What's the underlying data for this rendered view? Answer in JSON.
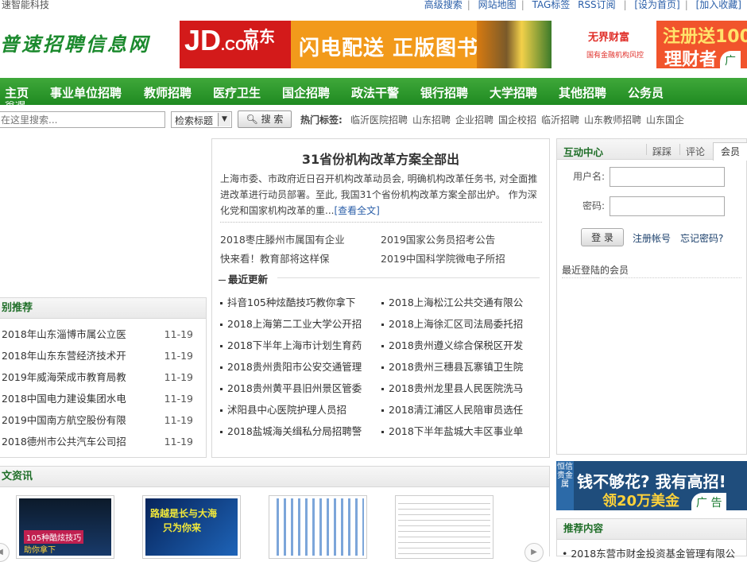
{
  "topbar": {
    "left_text": "速智能科技",
    "links": [
      "高级搜索",
      "网站地图",
      "TAG标签",
      "RSS订阅"
    ],
    "right_links": [
      "[设为首页]",
      "[加入收藏]"
    ]
  },
  "header": {
    "logo_text": "普速招聘信息网",
    "banner_jd": {
      "brand": "JD",
      "brand_suffix": ".COM",
      "brand_cn": "京东",
      "slogan": "闪电配送 正版图书"
    },
    "banner_right": {
      "brand": "无界财富",
      "sub": "国有金融机构风控",
      "line1": "注册送100",
      "line2": "理财者",
      "ad_label": "广"
    }
  },
  "nav": {
    "items": [
      "主页",
      "事业单位招聘",
      "教师招聘",
      "医疗卫生",
      "国企招聘",
      "政法干警",
      "银行招聘",
      "大学招聘",
      "其他招聘",
      "公务员"
    ],
    "cut_text": "资源"
  },
  "search": {
    "placeholder": "在这里搜索...",
    "select_value": "检索标题",
    "button_label": "搜 索",
    "hot_label": "热门标签:",
    "hot_tags": [
      "临沂医院招聘",
      "山东招聘",
      "企业招聘",
      "国企校招",
      "临沂招聘",
      "山东教师招聘",
      "山东国企"
    ]
  },
  "left_box": {
    "title": "别推荐",
    "items": [
      {
        "title": "2018年山东淄博市属公立医",
        "date": "11-19"
      },
      {
        "title": "2018年山东东营经济技术开",
        "date": "11-19"
      },
      {
        "title": "2019年威海荣成市教育局教",
        "date": "11-19"
      },
      {
        "title": "2018中国电力建设集团水电",
        "date": "11-19"
      },
      {
        "title": "2019中国南方航空股份有限",
        "date": "11-19"
      },
      {
        "title": "2018德州市公共汽车公司招",
        "date": "11-19"
      }
    ]
  },
  "center": {
    "headline": "31省份机构改革方案全部出",
    "summary": "上海市委、市政府近日召开机构改革动员会, 明确机构改革任务书, 对全面推进改革进行动员部署。至此, 我国31个省份机构改革方案全部出炉。 作为深化党和国家机构改革的重...",
    "more": "[查看全文]",
    "links": [
      "2018枣庄滕州市属国有企业",
      "2019国家公务员招考公告",
      "快来看！教育部将这样保",
      "2019中国科学院微电子所招"
    ],
    "recent_title": "最近更新",
    "news_left": [
      "抖音105种炫酷技巧教你拿下",
      "2018上海第二工业大学公开招",
      "2018下半年上海市计划生育药",
      "2018贵州贵阳市公安交通管理",
      "2018贵州黄平县旧州景区管委",
      "沭阳县中心医院护理人员招",
      "2018盐城海关缉私分局招聘警"
    ],
    "news_right": [
      "2018上海松江公共交通有限公",
      "2018上海徐汇区司法局委托招",
      "2018贵州遵义综合保税区开发",
      "2018贵州三穗县瓦寨镇卫生院",
      "2018贵州龙里县人民医院洗马",
      "2018清江浦区人民陪审员选任",
      "2018下半年盐城大丰区事业单"
    ]
  },
  "login": {
    "title": "互动中心",
    "tabs": [
      "踩踩",
      "评论"
    ],
    "active_tab": "会员",
    "username_label": "用户名:",
    "password_label": "密码:",
    "login_button": "登 录",
    "register_link": "注册帐号",
    "forgot_link": "忘记密码?",
    "recent_members": "最近登陆的会员"
  },
  "bottom": {
    "title": "文资讯",
    "thumb1_caption": "105种酷炫技巧",
    "thumb1_sub": "助你拿下",
    "thumb2_caption": "路越是长与大海",
    "thumb2_sub": "只为你来"
  },
  "ad_bottom": {
    "vertical": "恒信贵金属",
    "line1": "钱不够花? 我有高招!",
    "line2": "领20万美金",
    "ad_label": "广 告"
  },
  "recommend": {
    "title": "推荐内容",
    "item": "2018东营市财金投资基金管理有限公"
  }
}
